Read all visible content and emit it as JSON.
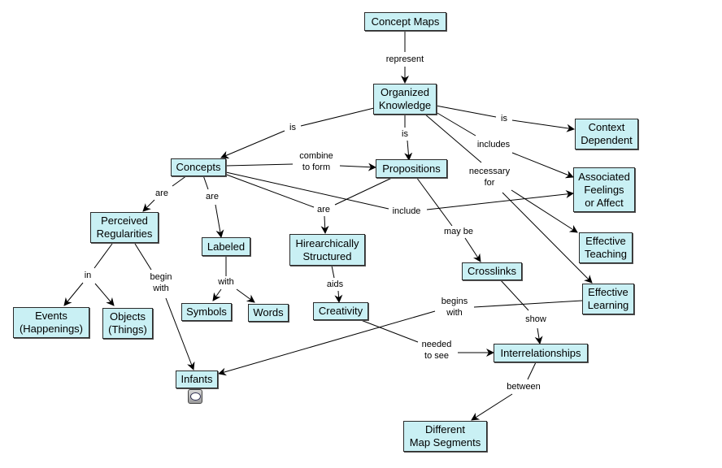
{
  "diagram_title": "Concept Maps",
  "colors": {
    "node_fill": "#c9f0f4",
    "node_border": "#2a2a2a",
    "line": "#000000",
    "background": "#ffffff"
  },
  "nodes": {
    "concept_maps": "Concept Maps",
    "organized_knowledge": "Organized\nKnowledge",
    "context_dependent": "Context\nDependent",
    "associated_feelings": "Associated\nFeelings\nor Affect",
    "concepts": "Concepts",
    "propositions": "Propositions",
    "effective_teaching": "Effective\nTeaching",
    "perceived_regularities": "Perceived\nRegularities",
    "labeled": "Labeled",
    "hierarchically_structured": "Hirearchically\nStructured",
    "crosslinks": "Crosslinks",
    "effective_learning": "Effective\nLearning",
    "events": "Events\n(Happenings)",
    "objects": "Objects\n(Things)",
    "symbols": "Symbols",
    "words": "Words",
    "creativity": "Creativity",
    "interrelationships": "Interrelationships",
    "infants": "Infants",
    "different_map_segments": "Different\nMap Segments"
  },
  "links": {
    "represent": "represent",
    "is_concepts": "is",
    "is_propositions": "is",
    "is_context": "is",
    "includes": "includes",
    "necessary_for": "necessary\nfor",
    "combine_to_form": "combine\nto form",
    "are_perceived": "are",
    "are_labeled": "are",
    "are_hier": "are",
    "include": "include",
    "may_be": "may be",
    "in": "in",
    "begin_with": "begin\nwith",
    "with": "with",
    "aids": "aids",
    "begins_with": "begins\nwith",
    "show": "show",
    "needed_to_see": "needed\nto see",
    "between": "between"
  },
  "icons": {
    "infants_note": "comment-bubble-icon"
  }
}
